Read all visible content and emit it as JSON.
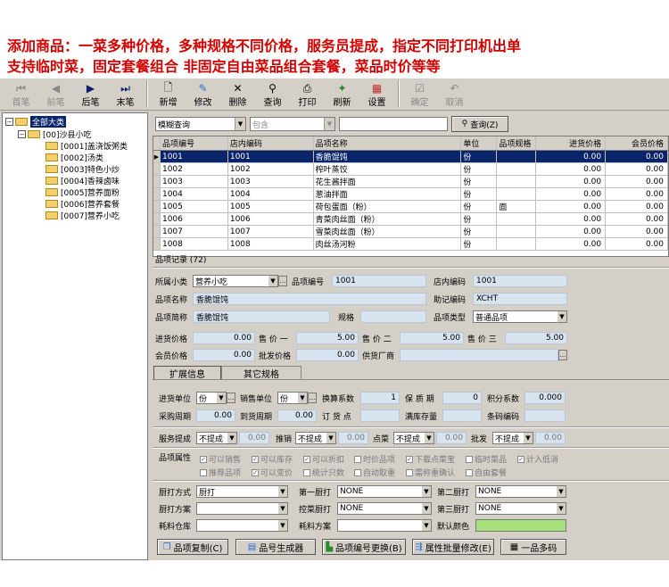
{
  "banner": {
    "line1": "添加商品：一菜多种价格，多种规格不同价格，服务员提成，指定不同打印机出单",
    "line2": "支持临时菜，固定套餐组合 非固定自由菜品组合套餐，菜品时价等等"
  },
  "toolbar": {
    "first": "首笔",
    "prev": "前笔",
    "next": "后笔",
    "last": "末笔",
    "add": "新增",
    "edit": "修改",
    "delete": "删除",
    "query": "查询",
    "print": "打印",
    "refresh": "刷新",
    "settings": "设置",
    "confirm": "确定",
    "cancel": "取消"
  },
  "tree": {
    "root": "全部大类",
    "group": "[00]沙县小吃",
    "items": [
      "[0001]盖浇饭粥类",
      "[0002]汤类",
      "[0003]特色小炒",
      "[0004]香辣卤味",
      "[0005]营养面粉",
      "[0006]营养套餐",
      "[0007]营养小吃"
    ]
  },
  "query": {
    "mode": "模糊查询",
    "op": "包含",
    "value": "",
    "button": "查询(Z)"
  },
  "grid": {
    "headers": [
      "品项编号",
      "店内编码",
      "品项名称",
      "单位",
      "品项规格",
      "进货价格",
      "会员价格"
    ],
    "rows": [
      [
        "1001",
        "1001",
        "香脆馄饨",
        "份",
        "",
        "0.00",
        "0.00"
      ],
      [
        "1002",
        "1002",
        "榨叶蒸饺",
        "份",
        "",
        "0.00",
        "0.00"
      ],
      [
        "1003",
        "1003",
        "花生酱拌面",
        "份",
        "",
        "0.00",
        "0.00"
      ],
      [
        "1004",
        "1004",
        "葱油拌面",
        "份",
        "",
        "0.00",
        "0.00"
      ],
      [
        "1005",
        "1005",
        "荷包蛋面（粉）",
        "份",
        "面",
        "0.00",
        "0.00"
      ],
      [
        "1006",
        "1006",
        "青菜肉丝面（粉）",
        "份",
        "",
        "0.00",
        "0.00"
      ],
      [
        "1007",
        "1007",
        "雪菜肉丝面（粉）",
        "份",
        "",
        "0.00",
        "0.00"
      ],
      [
        "1008",
        "1008",
        "肉丝汤河粉",
        "份",
        "",
        "0.00",
        "0.00"
      ]
    ],
    "footer": "品项记录 (72)"
  },
  "form": {
    "subclass_label": "所属小类",
    "subclass": "营养小吃",
    "code_label": "品项编号",
    "code": "1001",
    "store_code_label": "店内编码",
    "store_code": "1001",
    "name_label": "品项名称",
    "name": "香脆馄饨",
    "mnemonic_label": "助记编码",
    "mnemonic": "XCHT",
    "short_label": "品项简称",
    "short": "香脆馄饨",
    "spec_label": "规格",
    "spec": "",
    "type_label": "品项类型",
    "type": "普通品项",
    "cost_label": "进货价格",
    "cost": "0.00",
    "price1_label": "售 价 一",
    "price1": "5.00",
    "price2_label": "售 价 二",
    "price2": "5.00",
    "price3_label": "售 价 三",
    "price3": "5.00",
    "member_label": "会员价格",
    "member": "0.00",
    "wholesale_label": "批发价格",
    "wholesale": "0.00",
    "supplier_label": "供货厂商",
    "supplier": ""
  },
  "tabs": [
    "扩展信息",
    "其它规格"
  ],
  "ext": {
    "in_unit_label": "进货单位",
    "in_unit": "份",
    "sale_unit_label": "销售单位",
    "sale_unit": "份",
    "factor_label": "换算系数",
    "factor": "1",
    "shelf_label": "保 质 期",
    "shelf": "0",
    "points_label": "积分系数",
    "points": "0.000",
    "purchase_cycle_label": "采购周期",
    "purchase_cycle": "0.00",
    "arrival_label": "到货周期",
    "arrival": "0.00",
    "order_point_label": "订 货 点",
    "order_point": "",
    "full_stock_label": "满库存量",
    "full_stock": "",
    "barcode_label": "条码编码",
    "barcode": "",
    "commission_label": "服务提成",
    "commission_mode": "不提成",
    "commission": "0.00",
    "recommend_label": "推销",
    "recommend_mode": "不提成",
    "recommend": "0.00",
    "order_label": "点菜",
    "order_mode": "不提成",
    "order": "0.00",
    "approve_label": "批发",
    "approve_mode": "不提成",
    "approve": "0.00",
    "attr_label": "品项属性",
    "attrs_row1": [
      "可以销售",
      "可以库存",
      "可以折扣",
      "时价品项",
      "下载点菜宝",
      "临时菜品",
      "计入低消"
    ],
    "attrs_row2": [
      "推荐品项",
      "可以变价",
      "统计只数",
      "自动取重",
      "需称重确认",
      "自由套餐"
    ],
    "kitchen_mode_label": "厨打方式",
    "kitchen_mode": "厨打",
    "kitchen1_label": "第一厨打",
    "kitchen1": "NONE",
    "kitchen2_label": "第二厨打",
    "kitchen2": "NONE",
    "kitchen_plan_label": "厨打方案",
    "kitchen_plan": "",
    "control_label": "控菜厨打",
    "control": "NONE",
    "kitchen3_label": "第三厨打",
    "kitchen3": "NONE",
    "stock_label": "耗料仓库",
    "stock": "",
    "material_label": "耗料方案",
    "material": "",
    "color_label": "默认颜色",
    "color": "#a8e07a"
  },
  "bottom": {
    "copy": "品项复制(C)",
    "gen": "品号生成器",
    "change": "品项编号更换(B)",
    "batch": "属性批量修改(E)",
    "multi": "一品多码"
  }
}
